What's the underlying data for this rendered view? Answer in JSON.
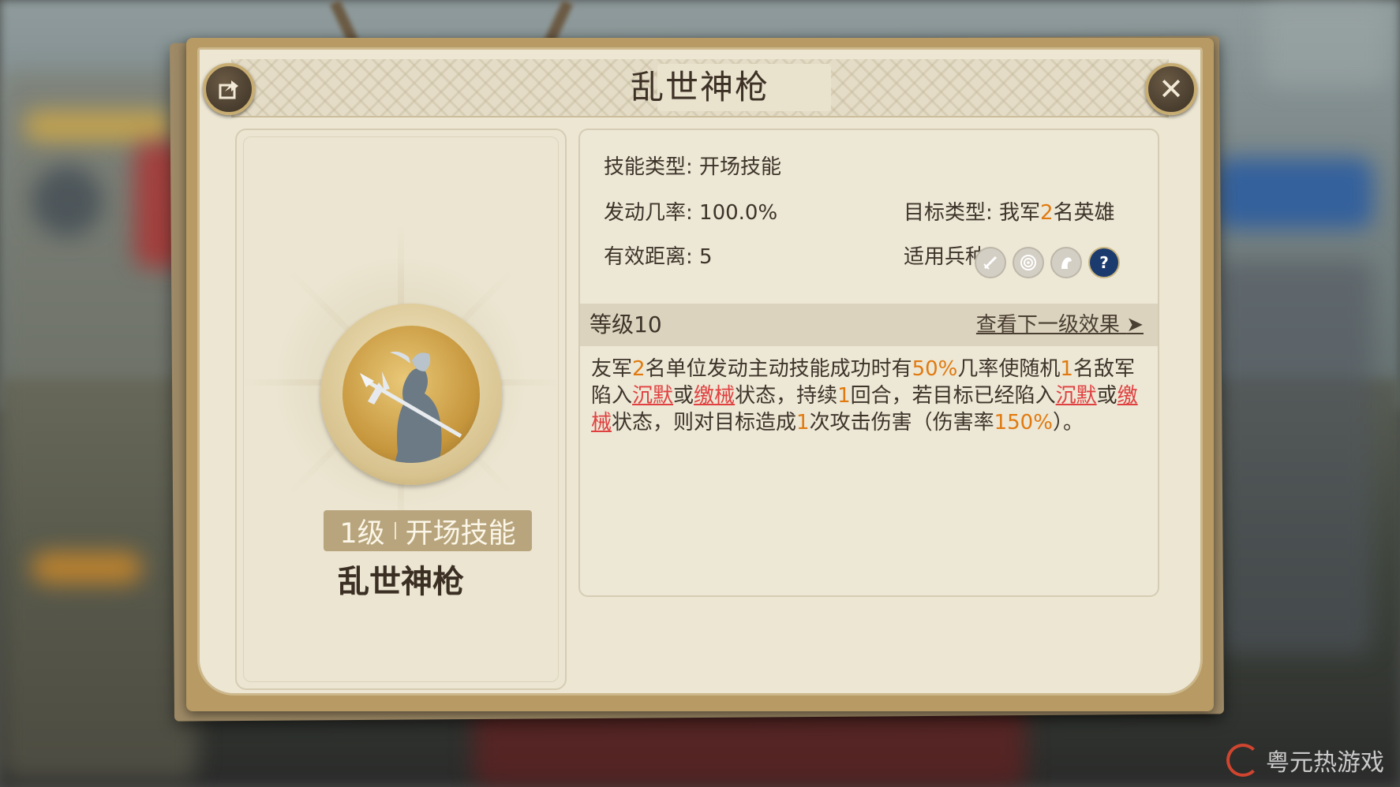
{
  "dialog": {
    "title": "乱世神枪"
  },
  "left": {
    "level": "1级",
    "skill_type_tag": "开场技能",
    "skill_name": "乱世神枪"
  },
  "right": {
    "skill_type_label": "技能类型:",
    "skill_type_value": "开场技能",
    "rate_label": "发动几率:",
    "rate_value": "100.0%",
    "target_label": "目标类型:",
    "target_value_pre": "我军",
    "target_value_num": "2",
    "target_value_post": "名英雄",
    "range_label": "有效距离:",
    "range_value": "5",
    "units_label": "适用兵种:",
    "unit_icons": [
      "infantry-icon",
      "archer-icon",
      "cavalry-icon",
      "unknown-unit-icon"
    ],
    "level_label": "等级10",
    "next_level_link": "查看下一级效果",
    "description": [
      {
        "t": "友军",
        "s": "n"
      },
      {
        "t": "2",
        "s": "hl"
      },
      {
        "t": "名单位发动主动技能成功时有",
        "s": "n"
      },
      {
        "t": "50%",
        "s": "hl"
      },
      {
        "t": "几率使随机",
        "s": "n"
      },
      {
        "t": "1",
        "s": "hl"
      },
      {
        "t": "名敌军陷入",
        "s": "n"
      },
      {
        "t": "沉默",
        "s": "red"
      },
      {
        "t": "或",
        "s": "n"
      },
      {
        "t": "缴械",
        "s": "red"
      },
      {
        "t": "状态，持续",
        "s": "n"
      },
      {
        "t": "1",
        "s": "hl"
      },
      {
        "t": "回合，若目标已经陷入",
        "s": "n"
      },
      {
        "t": "沉默",
        "s": "red"
      },
      {
        "t": "或",
        "s": "n"
      },
      {
        "t": "缴械",
        "s": "red"
      },
      {
        "t": "状态，则对目标造成",
        "s": "n"
      },
      {
        "t": "1",
        "s": "hl"
      },
      {
        "t": "次攻击伤害（伤害率",
        "s": "n"
      },
      {
        "t": "150%",
        "s": "hl"
      },
      {
        "t": "）。",
        "s": "n"
      }
    ]
  },
  "watermark": {
    "text": "粤元热游戏"
  },
  "colors": {
    "frame": "#b79a64",
    "panel": "#ece6d3",
    "highlight": "#e07a10",
    "status": "#e04040",
    "text": "#3d342a"
  }
}
